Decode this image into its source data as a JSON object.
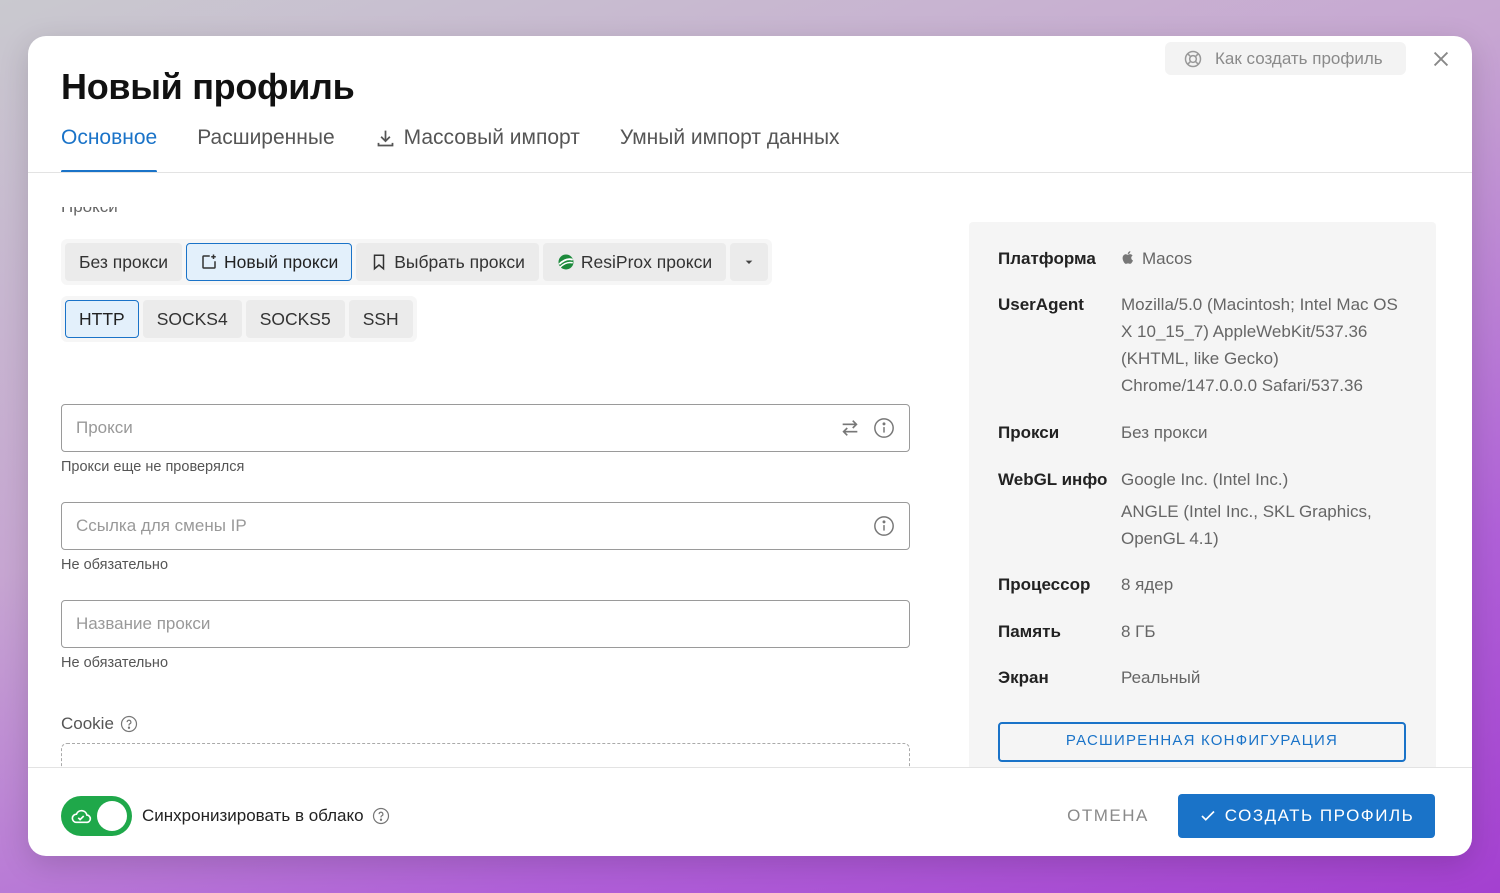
{
  "modal": {
    "title": "Новый профиль",
    "help_link": "Как создать профиль"
  },
  "tabs": [
    {
      "label": "Основное",
      "active": true
    },
    {
      "label": "Расширенные",
      "active": false
    },
    {
      "label": "Массовый импорт",
      "active": false,
      "icon": "download-icon"
    },
    {
      "label": "Умный импорт данных",
      "active": false
    }
  ],
  "proxy": {
    "section_label": "Прокси",
    "modes": [
      {
        "label": "Без прокси",
        "selected": false
      },
      {
        "label": "Новый прокси",
        "selected": true,
        "icon": "new-proxy-icon"
      },
      {
        "label": "Выбрать прокси",
        "selected": false,
        "icon": "bookmark-icon"
      },
      {
        "label": "ResiProx прокси",
        "selected": false,
        "icon": "resiprox-logo-icon"
      }
    ],
    "types": [
      {
        "label": "HTTP",
        "selected": true
      },
      {
        "label": "SOCKS4",
        "selected": false
      },
      {
        "label": "SOCKS5",
        "selected": false
      },
      {
        "label": "SSH",
        "selected": false
      }
    ],
    "proxy_field": {
      "placeholder": "Прокси",
      "value": "",
      "helper": "Прокси еще не проверялся"
    },
    "change_ip_field": {
      "placeholder": "Ссылка для смены IP",
      "value": "",
      "helper": "Не обязательно"
    },
    "name_field": {
      "placeholder": "Название прокси",
      "value": "",
      "helper": "Не обязательно"
    }
  },
  "cookie": {
    "label": "Cookie"
  },
  "summary": {
    "platform": {
      "key": "Платформа",
      "value": "Macos"
    },
    "useragent": {
      "key": "UserAgent",
      "value": "Mozilla/5.0 (Macintosh; Intel Mac OS X 10_15_7) AppleWebKit/537.36 (KHTML, like Gecko) Chrome/147.0.0.0 Safari/537.36"
    },
    "proxy": {
      "key": "Прокси",
      "value": "Без прокси"
    },
    "webgl": {
      "key": "WebGL инфо",
      "vendor": "Google Inc. (Intel Inc.)",
      "renderer": "ANGLE (Intel Inc., SKL Graphics, OpenGL 4.1)"
    },
    "cpu": {
      "key": "Процессор",
      "value": "8 ядер"
    },
    "memory": {
      "key": "Память",
      "value": "8 ГБ"
    },
    "screen": {
      "key": "Экран",
      "value": "Реальный"
    },
    "advanced_button": "РАСШИРЕННАЯ КОНФИГУРАЦИЯ"
  },
  "footer": {
    "sync_label": "Синхронизировать в облако",
    "sync_enabled": true,
    "cancel": "ОТМЕНА",
    "create": "СОЗДАТЬ ПРОФИЛЬ"
  },
  "colors": {
    "accent": "#1a73c8",
    "toggle_on": "#1fa84a"
  }
}
